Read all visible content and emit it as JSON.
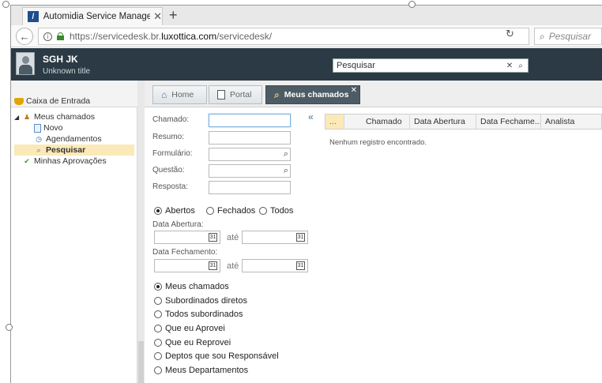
{
  "browser": {
    "tab_title": "Automidia Service Managem",
    "tab_close": "✕",
    "new_tab": "+",
    "url_prefix": "https://servicedesk.br.",
    "url_domain": "luxottica.com",
    "url_path": "/servicedesk/",
    "search_placeholder": "Pesquisar"
  },
  "header": {
    "user_name": "SGH JK",
    "user_title": "Unknown title",
    "search_value": "Pesquisar"
  },
  "sidebar": {
    "inbox_label": "Caixa de Entrada",
    "tree": [
      {
        "label": "Meus chamados",
        "icon": "user-icon"
      },
      {
        "label": "Novo",
        "icon": "document-icon"
      },
      {
        "label": "Agendamentos",
        "icon": "clock-icon"
      },
      {
        "label": "Pesquisar",
        "icon": "search-icon",
        "selected": true
      },
      {
        "label": "Minhas Aprovações",
        "icon": "check-icon"
      }
    ]
  },
  "tabs": [
    {
      "label": "Home",
      "icon": "home-icon"
    },
    {
      "label": "Portal",
      "icon": "page-icon"
    },
    {
      "label": "Meus chamados",
      "icon": "search-icon",
      "active": true
    }
  ],
  "form": {
    "collapse": "«",
    "fields": [
      {
        "label": "Chamado:",
        "lookup": false
      },
      {
        "label": "Resumo:",
        "lookup": false
      },
      {
        "label": "Formulário:",
        "lookup": true
      },
      {
        "label": "Questão:",
        "lookup": true
      },
      {
        "label": "Resposta:",
        "lookup": false
      }
    ],
    "status_options": [
      "Abertos",
      "Fechados",
      "Todos"
    ],
    "status_selected": "Abertos",
    "date_open_label": "Data Abertura:",
    "date_close_label": "Data Fechamento:",
    "ate": "até",
    "scope_options": [
      "Meus chamados",
      "Subordinados diretos",
      "Todos subordinados",
      "Que eu Aprovei",
      "Que eu Reprovei",
      "Deptos que sou Responsável",
      "Meus Departamentos"
    ],
    "scope_selected": "Meus chamados"
  },
  "grid": {
    "columns": [
      "...",
      "Chamado",
      "Data Abertura",
      "Data Fechame...",
      "Analista"
    ],
    "empty_message": "Nenhum registro encontrado."
  }
}
